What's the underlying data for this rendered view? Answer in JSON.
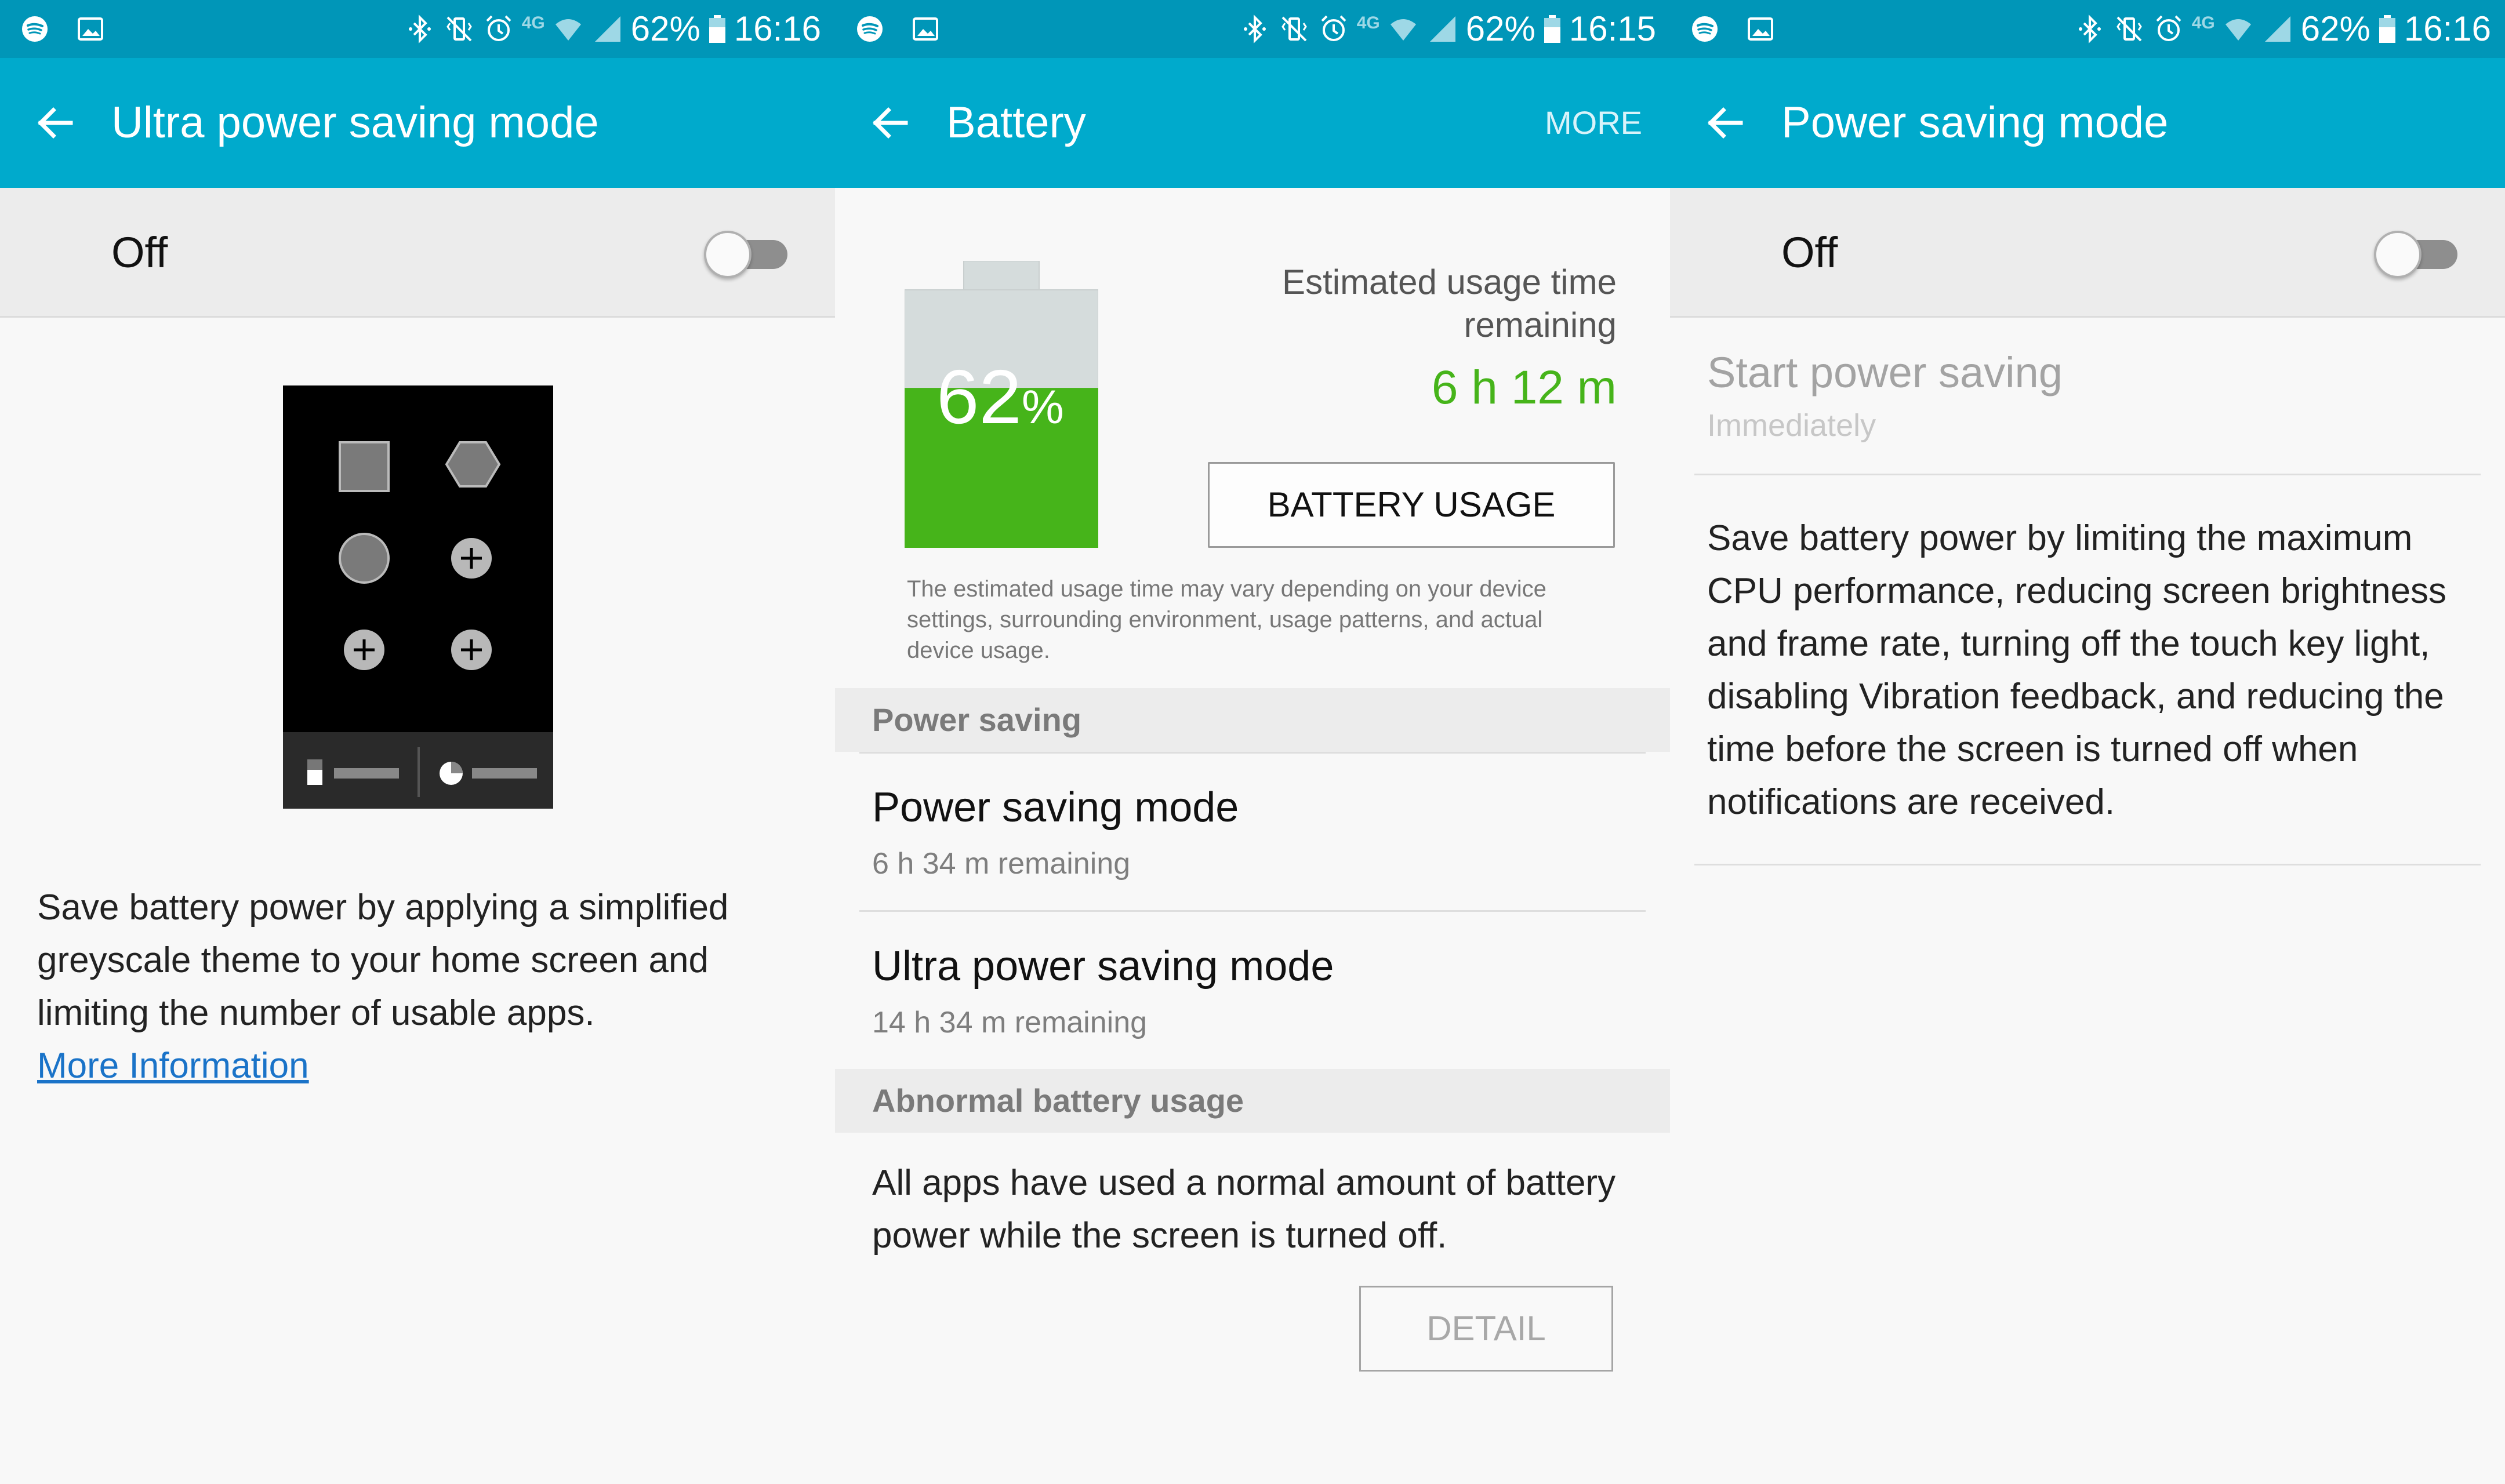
{
  "status_bar": {
    "left": {
      "battery": "62%",
      "time": "16:16"
    },
    "middle": {
      "battery": "62%",
      "time": "16:15"
    },
    "right": {
      "battery": "62%",
      "time": "16:16"
    },
    "network_label": "4G",
    "icons": [
      "spotify-icon",
      "gallery-icon",
      "bluetooth-icon",
      "vibrate-icon",
      "alarm-icon",
      "wifi-icon",
      "signal-icon",
      "battery-icon"
    ]
  },
  "panel_ultra": {
    "title": "Ultra power saving mode",
    "switch_label": "Off",
    "switch_on": false,
    "description": "Save battery power by applying a simplified greyscale theme to your home screen and limiting the number of usable apps.",
    "link": "More Information"
  },
  "panel_battery": {
    "title": "Battery",
    "more": "MORE",
    "level_number": "62",
    "level_unit": "%",
    "level_fraction": 0.62,
    "estimated_label": "Estimated usage time remaining",
    "estimated_value": "6 h 12 m",
    "usage_button": "BATTERY USAGE",
    "note": "The estimated usage time may vary depending on your device settings, surrounding environment, usage patterns, and actual device usage.",
    "section_power_saving": "Power saving",
    "items": [
      {
        "title": "Power saving mode",
        "subtitle": "6 h 34 m remaining"
      },
      {
        "title": "Ultra power saving mode",
        "subtitle": "14 h 34 m remaining"
      }
    ],
    "section_abnormal": "Abnormal battery usage",
    "abnormal_text": "All apps have used a normal amount of battery power while the screen is turned off.",
    "detail_button": "DETAIL"
  },
  "panel_power_saving": {
    "title": "Power saving mode",
    "switch_label": "Off",
    "switch_on": false,
    "start_title": "Start power saving",
    "start_value": "Immediately",
    "description": "Save battery power by limiting the maximum CPU performance, reducing screen brightness and frame rate, turning off the touch key light, disabling Vibration feedback, and reducing the time before the screen is turned off when notifications are received."
  },
  "colors": {
    "status_bar": "#0096b8",
    "app_bar": "#00aacc",
    "battery_green": "#46b41a",
    "battery_empty": "#d5dcdc",
    "link_blue": "#1a73c8"
  }
}
